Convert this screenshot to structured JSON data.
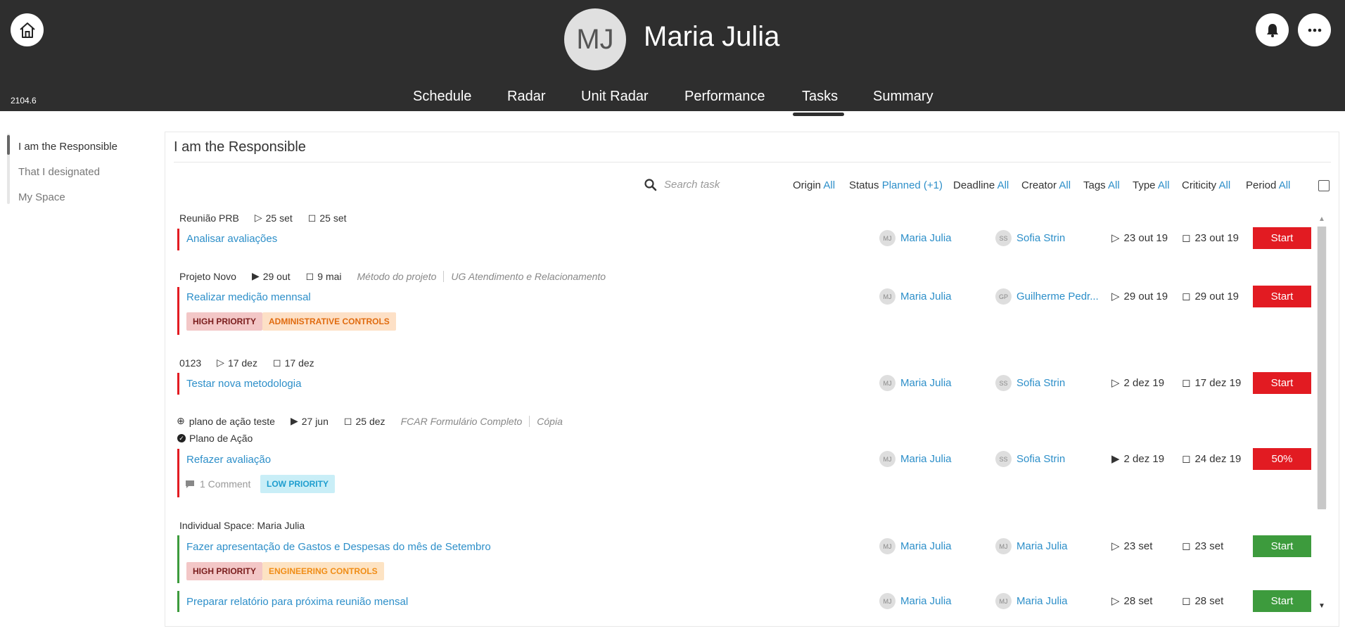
{
  "header": {
    "version": "2104.6",
    "avatar_initials": "MJ",
    "user_name": "Maria Julia",
    "nav": [
      "Schedule",
      "Radar",
      "Unit Radar",
      "Performance",
      "Tasks",
      "Summary"
    ],
    "active_tab": "Tasks"
  },
  "sidebar": {
    "items": [
      {
        "label": "I am the Responsible",
        "active": true
      },
      {
        "label": "That I designated",
        "active": false
      },
      {
        "label": "My Space",
        "active": false
      }
    ]
  },
  "main": {
    "title": "I am the Responsible",
    "search_placeholder": "Search task",
    "filters": [
      {
        "label": "Origin",
        "value": "All"
      },
      {
        "label": "Status",
        "value": "Planned (+1)"
      },
      {
        "label": "Deadline",
        "value": "All"
      },
      {
        "label": "Creator",
        "value": "All"
      },
      {
        "label": "Tags",
        "value": "All"
      },
      {
        "label": "Type",
        "value": "All"
      },
      {
        "label": "Criticity",
        "value": "All"
      },
      {
        "label": "Period",
        "value": "All"
      }
    ],
    "groups": [
      {
        "name": "Reunião PRB",
        "start": "25 set",
        "end": "25 set"
      },
      {
        "name": "Projeto Novo",
        "start": "29 out",
        "end": "9 mai",
        "meta1": "Método do projeto",
        "meta2": "UG Atendimento e Relacionamento"
      },
      {
        "name": "0123",
        "start": "17 dez",
        "end": "17 dez"
      },
      {
        "name": "plano de ação teste",
        "start": "27 jun",
        "end": "25 dez",
        "meta1": "FCAR Formulário Completo",
        "meta2": "Cópia",
        "sub": "Plano de Ação"
      },
      {
        "name": "Individual Space: Maria Julia"
      }
    ],
    "tasks": [
      {
        "title": "Analisar avaliações",
        "resp_initials": "MJ",
        "resp": "Maria Julia",
        "creator_initials": "SS",
        "creator": "Sofia Strin",
        "start": "23 out 19",
        "end": "23 out 19",
        "action": "Start",
        "color": "#e21b22"
      },
      {
        "title": "Realizar medição mennsal",
        "resp_initials": "MJ",
        "resp": "Maria Julia",
        "creator_initials": "GP",
        "creator": "Guilherme Pedr...",
        "start": "29 out 19",
        "end": "29 out 19",
        "action": "Start",
        "color": "#e21b22",
        "tags": [
          "HIGH PRIORITY",
          "ADMINISTRATIVE CONTROLS"
        ]
      },
      {
        "title": "Testar nova metodologia",
        "resp_initials": "MJ",
        "resp": "Maria Julia",
        "creator_initials": "SS",
        "creator": "Sofia Strin",
        "start": "2 dez 19",
        "end": "17 dez 19",
        "action": "Start",
        "color": "#e21b22"
      },
      {
        "title": "Refazer avaliação",
        "resp_initials": "MJ",
        "resp": "Maria Julia",
        "creator_initials": "SS",
        "creator": "Sofia Strin",
        "start": "2 dez 19",
        "end": "24 dez 19",
        "action": "50%",
        "color": "#e21b22",
        "comment": "1 Comment",
        "tags": [
          "LOW PRIORITY"
        ]
      },
      {
        "title": "Fazer apresentação de Gastos e Despesas do mês de Setembro",
        "resp_initials": "MJ",
        "resp": "Maria Julia",
        "creator_initials": "MJ",
        "creator": "Maria Julia",
        "start": "23 set",
        "end": "23 set",
        "action": "Start",
        "color": "#3d9b3d",
        "tags": [
          "HIGH PRIORITY",
          "ENGINEERING CONTROLS"
        ]
      },
      {
        "title": "Preparar relatório para próxima reunião mensal",
        "resp_initials": "MJ",
        "resp": "Maria Julia",
        "creator_initials": "MJ",
        "creator": "Maria Julia",
        "start": "28 set",
        "end": "28 set",
        "action": "Start",
        "color": "#3d9b3d"
      }
    ]
  },
  "colors": {
    "header_bg": "#2e2e2e",
    "link": "#2d8fc9",
    "red": "#e21b22",
    "green": "#3d9b3d"
  }
}
